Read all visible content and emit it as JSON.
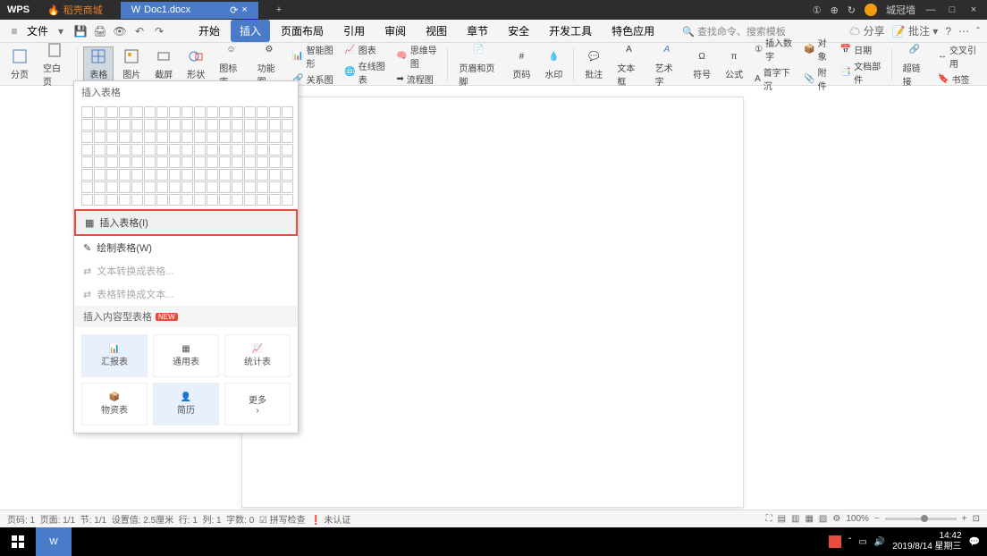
{
  "titlebar": {
    "wps": "WPS",
    "store_tab": "稻壳商城",
    "doc_tab": "Doc1.docx",
    "username": "城冠墙"
  },
  "menubar": {
    "file": "文件",
    "tabs": [
      "开始",
      "插入",
      "页面布局",
      "引用",
      "审阅",
      "视图",
      "章节",
      "安全",
      "开发工具",
      "特色应用"
    ],
    "active_tab": "插入",
    "search_placeholder": "查找命令、搜索模板",
    "share": "分享",
    "annotation": "批注"
  },
  "ribbon": {
    "page_break": "分页",
    "blank_page": "空白页",
    "table": "表格",
    "picture": "图片",
    "screenshot": "截屏",
    "shapes": "形状",
    "icons": "图标库",
    "functions": "功能图",
    "smart_graphic": "智能图形",
    "chart": "图表",
    "mindmap": "思维导图",
    "relation": "关系图",
    "online_chart": "在线图表",
    "flowchart": "流程图",
    "header_footer": "页眉和页脚",
    "page_num": "页码",
    "watermark": "水印",
    "comment": "批注",
    "textbox": "文本框",
    "wordart": "艺术字",
    "symbol": "符号",
    "equation": "公式",
    "insert_num": "插入数字",
    "object": "对象",
    "date": "日期",
    "drop_cap": "首字下沉",
    "attachment": "附件",
    "doc_parts": "文档部件",
    "hyperlink": "超链接",
    "cross_ref": "交叉引用",
    "bookmark": "书签"
  },
  "dropdown": {
    "title": "插入表格",
    "insert_table": "插入表格(I)",
    "draw_table": "绘制表格(W)",
    "text_to_table": "文本转换成表格...",
    "table_to_text": "表格转换成文本...",
    "content_section": "插入内容型表格",
    "new_label": "NEW",
    "templates": {
      "report": "汇报表",
      "general": "通用表",
      "stats": "统计表",
      "asset": "物资表",
      "resume": "简历",
      "more": "更多"
    }
  },
  "statusbar": {
    "page": "页码: 1",
    "pages": "页面: 1/1",
    "section": "节: 1/1",
    "position": "设置值: 2.5厘米",
    "row": "行: 1",
    "col": "列: 1",
    "chars": "字数: 0",
    "spellcheck": "拼写检查",
    "not_verified": "未认证",
    "zoom": "100%"
  },
  "taskbar": {
    "time": "14:42",
    "date": "2019/8/14 星期三"
  }
}
